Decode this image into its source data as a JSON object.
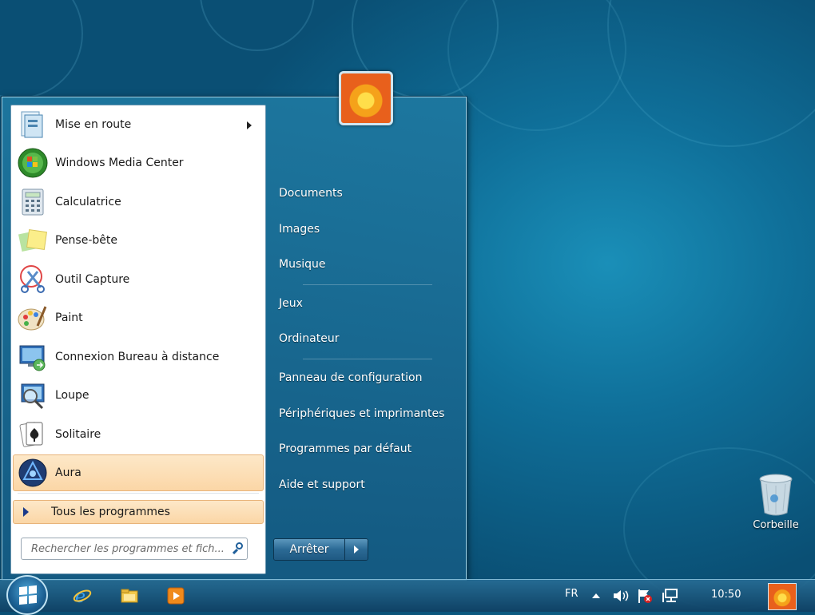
{
  "start_menu": {
    "programs": [
      {
        "label": "Mise en route",
        "icon": "mise-en-route-icon",
        "has_submenu": true,
        "highlighted": false
      },
      {
        "label": "Windows Media Center",
        "icon": "windows-media-center-icon",
        "has_submenu": false,
        "highlighted": false
      },
      {
        "label": "Calculatrice",
        "icon": "calculator-icon",
        "has_submenu": false,
        "highlighted": false
      },
      {
        "label": "Pense-bête",
        "icon": "sticky-notes-icon",
        "has_submenu": false,
        "highlighted": false
      },
      {
        "label": "Outil Capture",
        "icon": "snipping-tool-icon",
        "has_submenu": false,
        "highlighted": false
      },
      {
        "label": "Paint",
        "icon": "paint-icon",
        "has_submenu": false,
        "highlighted": false
      },
      {
        "label": "Connexion Bureau à distance",
        "icon": "remote-desktop-icon",
        "has_submenu": false,
        "highlighted": false
      },
      {
        "label": "Loupe",
        "icon": "magnifier-icon",
        "has_submenu": false,
        "highlighted": false
      },
      {
        "label": "Solitaire",
        "icon": "solitaire-icon",
        "has_submenu": false,
        "highlighted": false
      },
      {
        "label": "Aura",
        "icon": "aura-icon",
        "has_submenu": false,
        "highlighted": true
      }
    ],
    "all_programs_label": "Tous les programmes",
    "search_placeholder": "Rechercher les programmes et fich...",
    "right_links": [
      {
        "label": "Documents"
      },
      {
        "label": "Images"
      },
      {
        "label": "Musique"
      },
      {
        "label": "Jeux"
      },
      {
        "label": "Ordinateur"
      },
      {
        "label": "Panneau de configuration"
      },
      {
        "label": "Périphériques et imprimantes"
      },
      {
        "label": "Programmes par défaut"
      },
      {
        "label": "Aide et support"
      }
    ],
    "shutdown_label": "Arrêter"
  },
  "desktop": {
    "icons": [
      {
        "label": "Corbeille",
        "icon": "recycle-bin-icon"
      }
    ]
  },
  "taskbar": {
    "pinned": [
      "internet-explorer-icon",
      "windows-explorer-icon",
      "media-player-icon"
    ],
    "language": "FR",
    "clock": "10:50"
  },
  "colors": {
    "accent_highlight": "#fbd6a6",
    "desktop_blue": "#0f6f99",
    "menu_blue": "#1e78a0"
  }
}
